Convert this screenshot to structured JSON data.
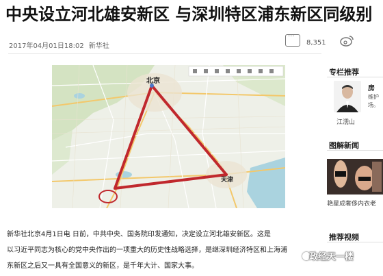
{
  "article": {
    "title": "中央设立河北雄安新区 与深圳特区浦东新区同级别",
    "date": "2017年04月01日18:02",
    "source": "新华社",
    "comment_count": "8,351",
    "paragraphs": [
      "新华社北京4月1日电  日前，中共中央、国务院印发通知，决定设立河北雄安新区。这是",
      "以习近平同志为核心的党中央作出的一项重大的历史性战略选择，是继深圳经济特区和上海浦",
      "东新区之后又一具有全国意义的新区，是千年大计、国家大事。"
    ]
  },
  "map": {
    "city_beijing": "北京",
    "city_tianjin": "天津",
    "line_color": "#c0282d"
  },
  "sidebar": {
    "section1_title": "专栏推荐",
    "columnist_name": "房",
    "columnist_text": "维护\n场。",
    "columnist_author": "江濡山",
    "section2_title": "图解新闻",
    "image_caption": "艳星成奢侈内衣老",
    "section3_title": "推荐视频"
  },
  "watermark": {
    "text": "政经天一楼"
  },
  "colors": {
    "accent_red": "#c0282d",
    "map_water": "#aad3df"
  }
}
